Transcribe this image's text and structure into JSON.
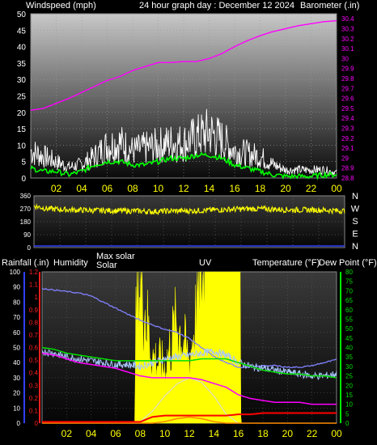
{
  "header": {
    "wind_label": "Windspeed (mph)",
    "title": "24 hour graph day : December 12 2024",
    "baro_label": "Barometer (.in)"
  },
  "bottom_header": {
    "rain_label": "Rainfall (.in)",
    "humidity_label": "Humidity",
    "max_solar_label": "Max solar",
    "solar_label": "Solar",
    "uv_label": "UV",
    "temp_label": "Temperature (°F)",
    "dew_label": "Dew Point (°F)"
  },
  "colors": {
    "background": "#000000",
    "wind_gust": "#ffffff",
    "wind_avg": "#00ff00",
    "barometer": "#ff00ff",
    "wind_dir": "#ffff00",
    "solar": "#ffff00",
    "max_solar": "#d8d8d8",
    "uv": "#ff8c00",
    "rain": "#ff0000",
    "humidity": "#8080ff",
    "temperature": "#00e000",
    "dew_point": "#ff00ff",
    "temp_trace": "#a8c8ff"
  },
  "chart_data": [
    {
      "type": "line",
      "name": "wind-barometer",
      "x_ticks": [
        "02",
        "04",
        "06",
        "08",
        "10",
        "12",
        "14",
        "16",
        "18",
        "20",
        "22",
        "00"
      ],
      "ylim_left": [
        0,
        50
      ],
      "yticks_left": [
        "0",
        "5",
        "10",
        "15",
        "20",
        "25",
        "30",
        "35",
        "40",
        "45",
        "50"
      ],
      "ylim_right": [
        28.8,
        30.45
      ],
      "yticks_right": [
        "28.8",
        "28.9",
        "29",
        "29.1",
        "29.2",
        "29.3",
        "29.4",
        "29.5",
        "29.6",
        "29.7",
        "29.8",
        "29.9",
        "30",
        "30.1",
        "30.2",
        "30.3",
        "30.4"
      ],
      "x": [
        0,
        1,
        2,
        3,
        4,
        5,
        6,
        7,
        8,
        9,
        10,
        11,
        12,
        13,
        14,
        15,
        16,
        17,
        18,
        19,
        20,
        21,
        22,
        23,
        24
      ],
      "series": [
        {
          "key": "wind_gust",
          "axis": "left",
          "values": [
            10,
            8,
            6,
            4,
            5,
            8,
            12,
            13,
            10,
            11,
            12,
            13,
            13,
            15,
            17,
            14,
            10,
            9,
            8,
            5,
            3,
            3,
            3,
            3,
            2
          ]
        },
        {
          "key": "wind_avg",
          "axis": "left",
          "values": [
            3,
            2,
            2,
            1,
            2,
            4,
            5,
            5,
            4,
            4,
            5,
            6,
            6,
            7,
            7,
            6,
            4,
            3,
            2,
            1,
            0.5,
            0.5,
            0.5,
            1,
            1
          ]
        },
        {
          "key": "barometer",
          "axis": "right",
          "values": [
            29.48,
            29.5,
            29.55,
            29.6,
            29.66,
            29.72,
            29.78,
            29.82,
            29.88,
            29.92,
            29.96,
            29.96,
            29.97,
            29.97,
            30.0,
            30.05,
            30.12,
            30.18,
            30.23,
            30.27,
            30.3,
            30.33,
            30.35,
            30.37,
            30.38
          ]
        }
      ]
    },
    {
      "type": "line",
      "name": "wind-direction",
      "yticks_left": [
        "0",
        "90",
        "180",
        "270",
        "360"
      ],
      "ylim": [
        0,
        360
      ],
      "compass": [
        "N",
        "W",
        "S",
        "E",
        "N"
      ],
      "x": [
        0,
        1,
        2,
        3,
        4,
        5,
        6,
        7,
        8,
        9,
        10,
        11,
        12,
        13,
        14,
        15,
        16,
        17,
        18,
        19,
        20,
        21,
        22,
        23,
        24
      ],
      "series": [
        {
          "key": "wind_dir",
          "values": [
            290,
            270,
            265,
            262,
            260,
            258,
            257,
            255,
            255,
            250,
            253,
            255,
            255,
            258,
            262,
            265,
            268,
            270,
            268,
            265,
            262,
            262,
            262,
            258,
            255
          ]
        }
      ]
    },
    {
      "type": "area",
      "name": "weather-multi",
      "x_ticks": [
        "02",
        "04",
        "06",
        "08",
        "10",
        "12",
        "14",
        "16",
        "18",
        "20",
        "22",
        "00"
      ],
      "yticks_rain": [
        "0",
        "0.1",
        "0.2",
        "0.3",
        "0.4",
        "0.5",
        "0.6",
        "0.7",
        "0.8",
        "0.9",
        "1",
        "1.1",
        "1.2"
      ],
      "ylim_rain": [
        0,
        1.2
      ],
      "yticks_hum": [
        "0",
        "10",
        "20",
        "30",
        "40",
        "50",
        "60",
        "70",
        "80",
        "90",
        "100"
      ],
      "ylim_hum": [
        0,
        100
      ],
      "yticks_temp": [
        "0",
        "5",
        "10",
        "15",
        "20",
        "25",
        "30",
        "35",
        "40",
        "45",
        "50",
        "55",
        "60",
        "65",
        "70",
        "75",
        "80"
      ],
      "ylim_temp": [
        0,
        80
      ],
      "x": [
        0,
        1,
        2,
        3,
        4,
        5,
        6,
        7,
        8,
        9,
        10,
        11,
        12,
        13,
        14,
        15,
        16,
        17,
        18,
        19,
        20,
        21,
        22,
        23,
        24
      ],
      "series": [
        {
          "key": "humidity",
          "axis": "hum",
          "values": [
            89,
            88,
            87,
            86,
            84,
            80,
            76,
            72,
            68,
            65,
            62,
            60,
            56,
            50,
            44,
            40,
            37,
            37,
            38,
            38,
            37,
            37,
            38,
            40,
            42
          ]
        },
        {
          "key": "temperature",
          "axis": "temp",
          "values": [
            40,
            39,
            37,
            36,
            35,
            34,
            33,
            33,
            33,
            33,
            33,
            33,
            33,
            34,
            34,
            34,
            32,
            30,
            28,
            27,
            26,
            26,
            25,
            25,
            24
          ]
        },
        {
          "key": "dew_point",
          "axis": "temp",
          "values": [
            37,
            36,
            34,
            32,
            31,
            30,
            29,
            27,
            25,
            24,
            24,
            24,
            24,
            23,
            21,
            19,
            15,
            13,
            12,
            11,
            11,
            11,
            10,
            10,
            10
          ]
        },
        {
          "key": "temp_trace",
          "axis": "temp",
          "values": [
            38,
            37,
            35,
            34,
            33,
            32,
            31,
            31,
            30,
            32,
            34,
            35,
            36,
            37,
            38,
            36,
            32,
            30,
            29,
            28,
            27,
            26,
            25,
            25,
            26
          ]
        },
        {
          "key": "rain",
          "axis": "rain",
          "values": [
            0.01,
            0.01,
            0.01,
            0.01,
            0.01,
            0.01,
            0.01,
            0.01,
            0.01,
            0.05,
            0.06,
            0.06,
            0.06,
            0.06,
            0.06,
            0.06,
            0.07,
            0.07,
            0.08,
            0.08,
            0.08,
            0.08,
            0.08,
            0.08,
            0.08
          ]
        },
        {
          "key": "max_solar",
          "axis": "hum",
          "values": [
            0,
            0,
            0,
            0,
            0,
            0,
            0,
            0,
            1,
            8,
            18,
            26,
            30,
            27,
            18,
            6,
            0,
            0,
            0,
            0,
            0,
            0,
            0,
            0,
            0
          ]
        },
        {
          "key": "uv",
          "axis": "hum",
          "values": [
            0,
            0,
            0,
            0,
            0,
            0,
            0,
            0,
            0,
            0,
            1,
            3,
            4,
            3,
            1,
            0,
            0,
            0,
            0,
            0,
            0,
            0,
            0,
            0,
            0
          ]
        },
        {
          "key": "solar",
          "axis": "hum",
          "values": [
            0,
            0,
            0,
            0,
            0,
            0,
            0,
            0,
            100,
            45,
            38,
            70,
            42,
            100,
            100,
            100,
            0,
            0,
            0,
            0,
            0,
            0,
            0,
            0,
            0
          ]
        }
      ]
    }
  ]
}
